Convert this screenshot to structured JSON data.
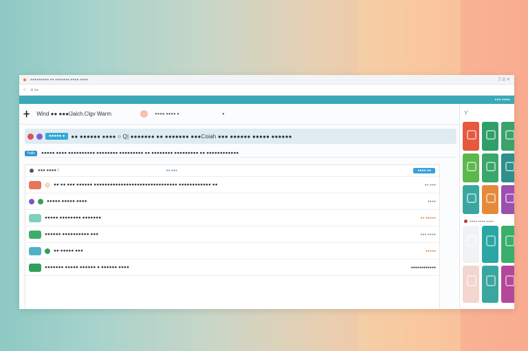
{
  "browser": {
    "tab_title": "●●●●●●●●● ●● ●●●●●●● ●●●● ●●●●",
    "tab_controls": "Ξ ⊡ ✕",
    "url": "⊕ ●●",
    "nav_glyph": "○",
    "teal_label": "●●● ●●●●"
  },
  "app": {
    "logo_glyph": "ⵜ",
    "title": "Wind ●● ●●●lJaich.Clgv Warm",
    "header_link": "●●●● ●●●● ●",
    "header_mid": "●"
  },
  "search": {
    "button_label": "●●●●● ●",
    "query": "●● ●●●●●● ●●●● ○ Q| ●●●●●●● ●● ●●●●●●● ●●●Coiah ●●● ●●●●●● ●●●●● ●●●●●●"
  },
  "subtoolbar": {
    "tag": "Yiallo",
    "text": "●●●●● ●●●● ●●●●●●●●●● ●●●●●●●● ●●●●●●●●● ●● ●●●●●●●● ●●●●●●●●● ●● ●●●●●●●●●●●●"
  },
  "list": {
    "title": "●●● ●●●● /",
    "mid_label": "●● ●●●",
    "button": "●●●● ●●",
    "rows": [
      {
        "text": "●● ●● ●●● ●●●●●● ●●●●●●●●●●●●●●●●●●●●●●●●●●●●●●● ●●●●●●●●●●●● ●●",
        "meta": "●● ●●●"
      },
      {
        "text": "●●●●● ●●●●● ●●●●",
        "meta": "●●●●"
      },
      {
        "text": "●●●●● ●●●●●●●● ●●●●●●●",
        "meta": "●● ●●●●●"
      },
      {
        "text": "●●●●●● ●●●●●●●●●● ●●●",
        "meta": "●●● ●●●●"
      },
      {
        "text": "●● ●●●●● ●●●",
        "meta": "●●●●●"
      },
      {
        "text": "●●●●●●● ●●●●● ●●●●●● ● ●●●●●● ●●●●",
        "meta": "●●●●●●●●●●●●"
      }
    ]
  },
  "sidebar": {
    "head_glyph": "Ƴ",
    "mid_text": "●●●● ●●●● ●●●●"
  },
  "colors": {
    "accent": "#3aa8b8",
    "button_blue": "#35a9d8",
    "search_panel": "#dfecf1"
  }
}
